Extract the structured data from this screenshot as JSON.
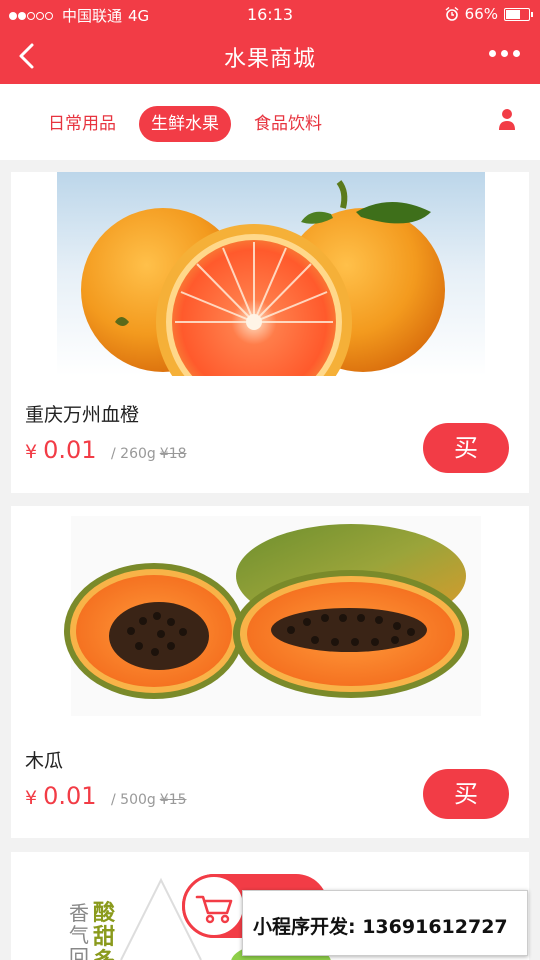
{
  "status_bar": {
    "carrier": "中国联通",
    "network": "4G",
    "time": "16:13",
    "battery": "66%",
    "battery_level": 0.66
  },
  "nav": {
    "title": "水果商城",
    "back_icon": "chevron-left-icon",
    "more_icon": "more-dots-icon"
  },
  "tabs": [
    {
      "label": "日常用品",
      "active": false
    },
    {
      "label": "生鲜水果",
      "active": true
    },
    {
      "label": "食品饮料",
      "active": false
    }
  ],
  "products": [
    {
      "name": "重庆万州血橙",
      "currency": "¥",
      "price": "0.01",
      "unit": "/ 260g",
      "original_price": "¥18",
      "buy_label": "买"
    },
    {
      "name": "木瓜",
      "currency": "¥",
      "price": "0.01",
      "unit": "/ 500g",
      "original_price": "¥15",
      "buy_label": "买"
    }
  ],
  "third_card": {
    "image_text_1": "香气回",
    "image_text_2": "酸甜多"
  },
  "ad": {
    "text": "小程序开发: 13691612727"
  },
  "colors": {
    "primary": "#f23c46",
    "orange": "#f39a1e",
    "papaya_skin": "#6d8f2e"
  }
}
